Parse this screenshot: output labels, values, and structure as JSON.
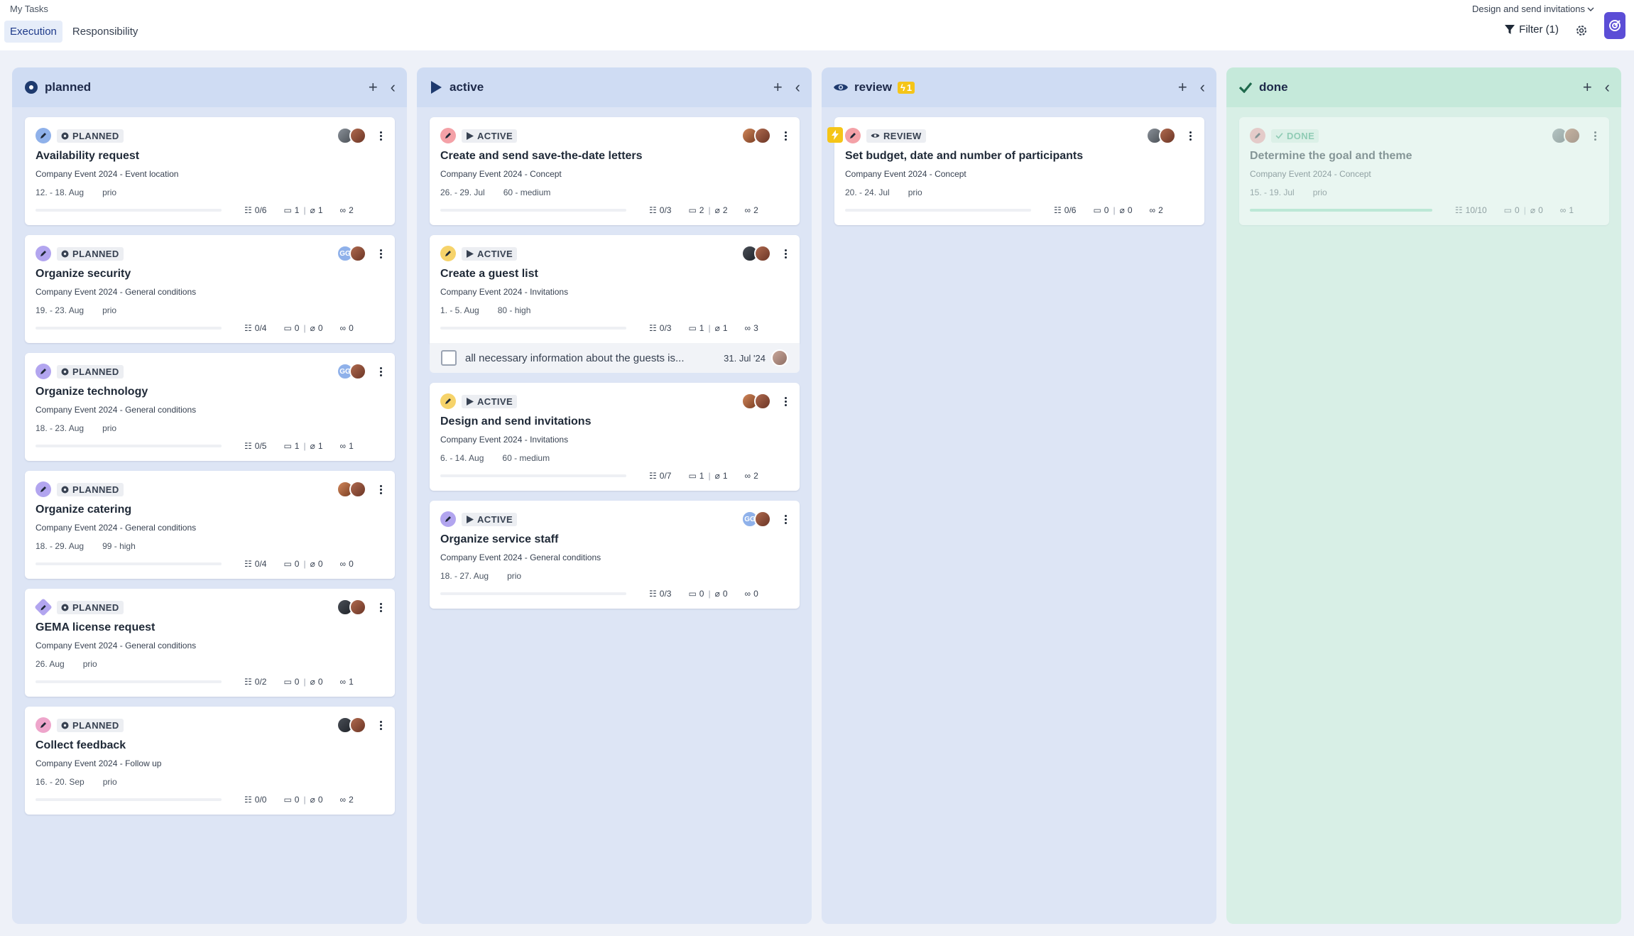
{
  "header": {
    "breadcrumb": "My Tasks",
    "tabs": [
      {
        "label": "Execution"
      },
      {
        "label": "Responsibility"
      }
    ],
    "project_select": "Design and send invitations",
    "filter_label": "Filter (1)"
  },
  "colors": {
    "accent": "#5b4dd6",
    "pencil_blue": "#8fb1ea",
    "pencil_purple": "#b2a5ef",
    "pencil_red": "#f4a1a7",
    "pencil_yellow": "#f6d36a",
    "pencil_pink": "#eea5cb",
    "review_badge": "#f5c518"
  },
  "columns": [
    {
      "title": "planned",
      "icon": "planned-circle-icon",
      "cards": [
        {
          "status": "PLANNED",
          "title": "Availability request",
          "subtitle": "Company Event 2024 - Event location",
          "dates": "12. - 18. Aug",
          "priority": "prio",
          "checklist": "0/6",
          "comments": "1",
          "attachments": "1",
          "links": "2",
          "progress": 0
        },
        {
          "status": "PLANNED",
          "title": "Organize security",
          "subtitle": "Company Event 2024 - General conditions",
          "dates": "19. - 23. Aug",
          "priority": "prio",
          "checklist": "0/4",
          "comments": "0",
          "attachments": "0",
          "links": "0",
          "progress": 0,
          "initials": "GG"
        },
        {
          "status": "PLANNED",
          "title": "Organize technology",
          "subtitle": "Company Event 2024 - General conditions",
          "dates": "18. - 23. Aug",
          "priority": "prio",
          "checklist": "0/5",
          "comments": "1",
          "attachments": "1",
          "links": "1",
          "progress": 0,
          "initials": "GG"
        },
        {
          "status": "PLANNED",
          "title": "Organize catering",
          "subtitle": "Company Event 2024 - General conditions",
          "dates": "18. - 29. Aug",
          "priority": "99 - high",
          "checklist": "0/4",
          "comments": "0",
          "attachments": "0",
          "links": "0",
          "progress": 0
        },
        {
          "status": "PLANNED",
          "title": "GEMA license request",
          "subtitle": "Company Event 2024 - General conditions",
          "dates": "26. Aug",
          "priority": "prio",
          "checklist": "0/2",
          "comments": "0",
          "attachments": "0",
          "links": "1",
          "progress": 0
        },
        {
          "status": "PLANNED",
          "title": "Collect feedback",
          "subtitle": "Company Event 2024 - Follow up",
          "dates": "16. - 20. Sep",
          "priority": "prio",
          "checklist": "0/0",
          "comments": "0",
          "attachments": "0",
          "links": "2",
          "progress": 0
        }
      ]
    },
    {
      "title": "active",
      "icon": "play-icon",
      "cards": [
        {
          "status": "ACTIVE",
          "title": "Create and send save-the-date letters",
          "subtitle": "Company Event 2024 - Concept",
          "dates": "26. - 29. Jul",
          "priority": "60 - medium",
          "checklist": "0/3",
          "comments": "2",
          "attachments": "2",
          "links": "2",
          "progress": 0
        },
        {
          "status": "ACTIVE",
          "title": "Create a guest list",
          "subtitle": "Company Event 2024 - Invitations",
          "dates": "1. - 5. Aug",
          "priority": "80 - high",
          "checklist": "0/3",
          "comments": "1",
          "attachments": "1",
          "links": "3",
          "progress": 0,
          "checklist_item": {
            "text": "all necessary information about the guests is...",
            "date": "31. Jul '24"
          }
        },
        {
          "status": "ACTIVE",
          "title": "Design and send invitations",
          "subtitle": "Company Event 2024 - Invitations",
          "dates": "6. - 14. Aug",
          "priority": "60 - medium",
          "checklist": "0/7",
          "comments": "1",
          "attachments": "1",
          "links": "2",
          "progress": 0
        },
        {
          "status": "ACTIVE",
          "title": "Organize service staff",
          "subtitle": "Company Event 2024 - General conditions",
          "dates": "18. - 27. Aug",
          "priority": "prio",
          "checklist": "0/3",
          "comments": "0",
          "attachments": "0",
          "links": "0",
          "progress": 0,
          "initials": "GG"
        }
      ]
    },
    {
      "title": "review",
      "icon": "eye-icon",
      "badge": "1",
      "cards": [
        {
          "status": "REVIEW",
          "title": "Set budget, date and number of participants",
          "subtitle": "Company Event 2024 - Concept",
          "dates": "20. - 24. Jul",
          "priority": "prio",
          "checklist": "0/6",
          "comments": "0",
          "attachments": "0",
          "links": "2",
          "progress": 0
        }
      ]
    },
    {
      "title": "done",
      "icon": "checkmark-icon",
      "cards": [
        {
          "status": "DONE",
          "title": "Determine the goal and theme",
          "subtitle": "Company Event 2024 - Concept",
          "dates": "15. - 19. Jul",
          "priority": "prio",
          "checklist": "10/10",
          "comments": "0",
          "attachments": "0",
          "links": "1",
          "progress": 1
        }
      ]
    }
  ]
}
